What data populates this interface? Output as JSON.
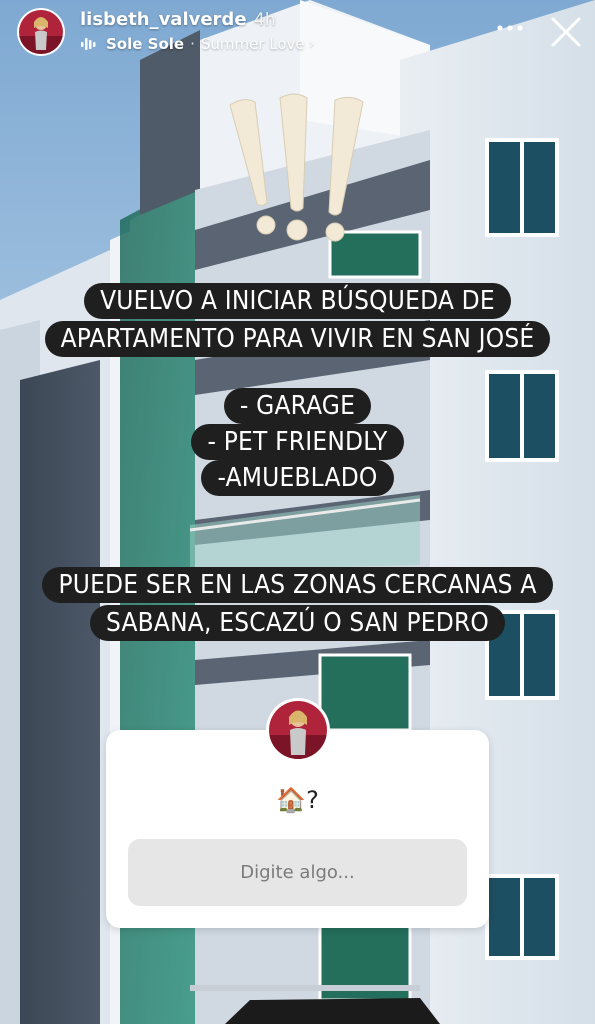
{
  "story": {
    "username": "lisbeth_valverde",
    "time_ago": "4h",
    "music": {
      "artist": "Sole Sole",
      "separator": "·",
      "song": "Summer Love",
      "chevron": "›"
    }
  },
  "icons": {
    "more": "more-dots-icon",
    "close": "close-icon",
    "music": "music-bars-icon"
  },
  "text_blocks": {
    "block1": [
      "VUELVO A INICIAR BÚSQUEDA DE",
      "APARTAMENTO PARA VIVIR EN SAN JOSÉ"
    ],
    "block2": [
      "- GARAGE",
      "- PET FRIENDLY",
      "-AMUEBLADO"
    ],
    "block3": [
      "PUEDE SER EN LAS ZONAS CERCANAS A",
      "SABANA, ESCAZÚ O SAN PEDRO"
    ]
  },
  "question_sticker": {
    "title": "🏠?",
    "input_placeholder": "Digite algo..."
  },
  "colors": {
    "text_bg": "#1f1f1f",
    "sticker_bg": "#ffffff",
    "input_bg": "#e6e6e6"
  }
}
